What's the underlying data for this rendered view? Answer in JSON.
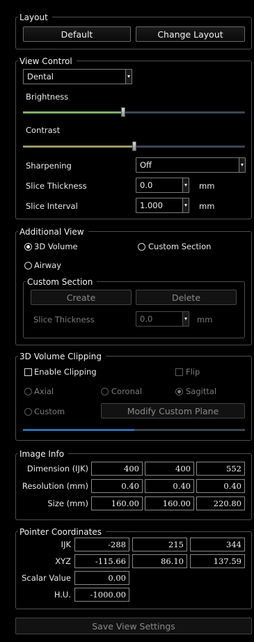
{
  "layout": {
    "title": "Layout",
    "default_label": "Default",
    "change_label": "Change Layout"
  },
  "view_control": {
    "title": "View Control",
    "preset": "Dental",
    "brightness": {
      "label": "Brightness",
      "value": 0.45,
      "fill_color": "#7fae6a"
    },
    "contrast": {
      "label": "Contrast",
      "value": 0.5,
      "fill_color": "#9a9a62"
    },
    "sharpening": {
      "label": "Sharpening",
      "value": "Off"
    },
    "slice_thickness": {
      "label": "Slice Thickness",
      "value": "0.0",
      "unit": "mm"
    },
    "slice_interval": {
      "label": "Slice Interval",
      "value": "1.000",
      "unit": "mm"
    }
  },
  "additional_view": {
    "title": "Additional View",
    "options": [
      "3D Volume",
      "Custom Section",
      "Airway"
    ],
    "selected": "3D Volume",
    "custom_section": {
      "title": "Custom Section",
      "create_label": "Create",
      "delete_label": "Delete",
      "thickness_label": "Slice Thickness",
      "thickness_value": "0.0",
      "thickness_unit": "mm"
    }
  },
  "clipping": {
    "title": "3D Volume Clipping",
    "enable_label": "Enable Clipping",
    "flip_label": "Flip",
    "planes": [
      "Axial",
      "Coronal",
      "Sagittal",
      "Custom"
    ],
    "selected_plane": "Sagittal",
    "modify_label": "Modify Custom Plane",
    "position": 0.5,
    "position_color": "#2f6fb0"
  },
  "image_info": {
    "title": "Image Info",
    "rows": [
      {
        "label": "Dimension (IJK)",
        "values": [
          "400",
          "400",
          "552"
        ]
      },
      {
        "label": "Resolution (mm)",
        "values": [
          "0.40",
          "0.40",
          "0.40"
        ]
      },
      {
        "label": "Size (mm)",
        "values": [
          "160.00",
          "160.00",
          "220.80"
        ]
      }
    ]
  },
  "pointer": {
    "title": "Pointer Coordinates",
    "ijk_label": "IJK",
    "ijk": [
      "-288",
      "215",
      "344"
    ],
    "xyz_label": "XYZ",
    "xyz": [
      "-115.66",
      "86.10",
      "137.59"
    ],
    "scalar_label": "Scalar Value",
    "scalar": "0.00",
    "hu_label": "H.U.",
    "hu": "-1000.00"
  },
  "save_label": "Save View Settings"
}
